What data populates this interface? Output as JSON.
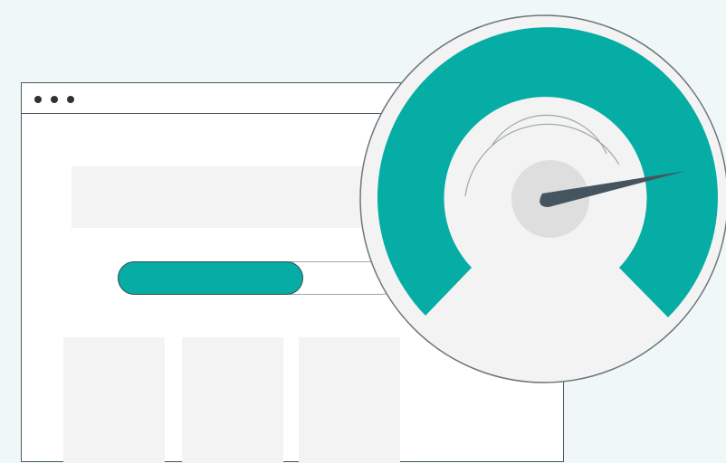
{
  "illustration": {
    "progress": {
      "value": 0.66
    },
    "gauge": {
      "level": 0.9,
      "accent_color": "#05ada4",
      "needle_color": "#455560"
    },
    "icons": [
      "window-dots-icon",
      "speedometer-icon"
    ]
  }
}
